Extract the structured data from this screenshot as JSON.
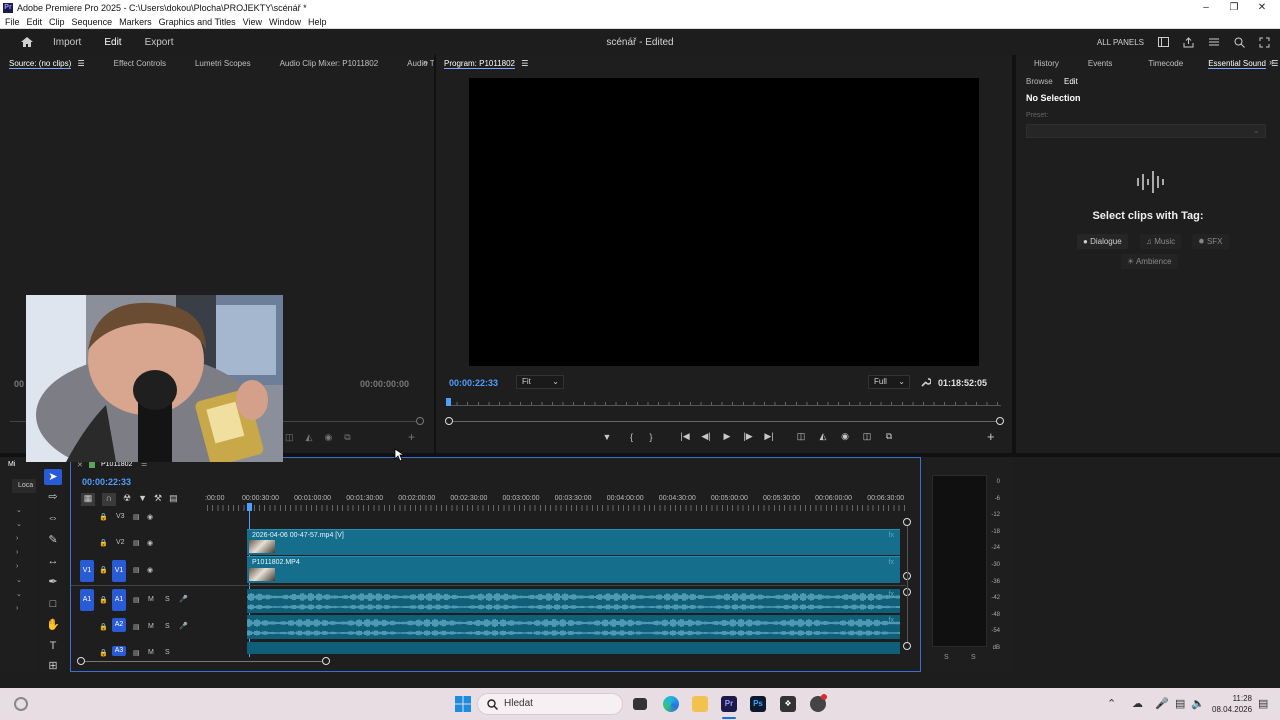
{
  "window": {
    "title": "Adobe Premiere Pro 2025 - C:\\Users\\dokou\\Plocha\\PROJEKTY\\scénář *"
  },
  "menu": [
    "File",
    "Edit",
    "Clip",
    "Sequence",
    "Markers",
    "Graphics and Titles",
    "View",
    "Window",
    "Help"
  ],
  "header": {
    "tabs": [
      "Import",
      "Edit",
      "Export"
    ],
    "doc_title": "scénář - Edited",
    "all_panels": "ALL PANELS"
  },
  "source_panel": {
    "tabs": [
      "Source: (no clips)",
      "Effect Controls",
      "Lumetri Scopes",
      "Audio Clip Mixer: P1011802",
      "Audio Track Mixe"
    ],
    "timecode_left": "00",
    "timecode_right": "00:00:00:00"
  },
  "program_panel": {
    "tab": "Program: P1011802",
    "timecode": "00:00:22:33",
    "fit": "Fit",
    "quality": "Full",
    "duration": "01:18:52:05"
  },
  "essential_sound": {
    "tabs": [
      "History",
      "Events",
      "Timecode",
      "Essential Sound"
    ],
    "subtabs": [
      "Browse",
      "Edit"
    ],
    "no_selection": "No Selection",
    "preset_label": "Preset:",
    "heading": "Select clips with Tag:",
    "tags": [
      "Dialogue",
      "Music",
      "SFX",
      "Ambience"
    ]
  },
  "project_panel": {
    "tab": "Mi",
    "loc": "Loca"
  },
  "timeline": {
    "sequence": "P1011802",
    "timecode": "00:00:22:33",
    "ruler": [
      ":00:00",
      "00:00:30:00",
      "00:01:00:00",
      "00:01:30:00",
      "00:02:00:00",
      "00:02:30:00",
      "00:03:00:00",
      "00:03:30:00",
      "00:04:00:00",
      "00:04:30:00",
      "00:05:00:00",
      "00:05:30:00",
      "00:06:00:00",
      "00:06:30:00"
    ],
    "tracks": {
      "v3": "V3",
      "v2": "V2",
      "v1": "V1",
      "a1": "A1",
      "a2": "A2",
      "a3": "A3",
      "m": "M",
      "s": "S"
    },
    "clips": {
      "v2_name": "2026-04-06 00-47-57.mp4 [V]",
      "v1_name": "P1011802.MP4"
    }
  },
  "meter": {
    "scale": [
      "0",
      "-6",
      "-12",
      "-18",
      "-24",
      "-30",
      "-36",
      "-42",
      "-48",
      "-54",
      "dB"
    ],
    "solo": [
      "S",
      "S"
    ]
  },
  "taskbar": {
    "search": "Hledat",
    "time": "11:28",
    "date": "08.04.2026"
  },
  "colors": {
    "accent": "#2a5bd7",
    "timecode_blue": "#4f9fff",
    "clip_video": "#156e8c",
    "clip_audio": "#0f5f78"
  }
}
